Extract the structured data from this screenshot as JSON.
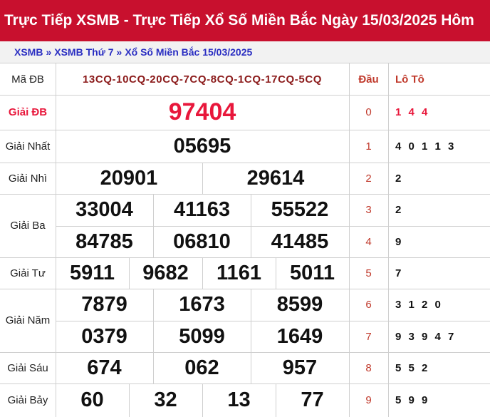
{
  "header": {
    "title": "Trực Tiếp XSMB - Trực Tiếp Xổ Số Miền Bắc Ngày 15/03/2025 Hôm"
  },
  "breadcrumb": {
    "items": [
      "XSMB",
      "XSMB Thứ 7",
      "Xổ Số Miền Bắc 15/03/2025"
    ],
    "separator": "»"
  },
  "table": {
    "code_label": "Mã ĐB",
    "code_value": "13CQ-10CQ-20CQ-7CQ-8CQ-1CQ-17CQ-5CQ",
    "dau_header": "Đầu",
    "loto_header": "Lô Tô",
    "prizes": {
      "db": {
        "label": "Giải ĐB",
        "numbers": [
          "97404"
        ]
      },
      "nhat": {
        "label": "Giải Nhất",
        "numbers": [
          "05695"
        ]
      },
      "nhi": {
        "label": "Giải Nhì",
        "numbers": [
          "20901",
          "29614"
        ]
      },
      "ba": {
        "label": "Giải Ba",
        "numbers": [
          "33004",
          "41163",
          "55522",
          "84785",
          "06810",
          "41485"
        ]
      },
      "tu": {
        "label": "Giải Tư",
        "numbers": [
          "5911",
          "9682",
          "1161",
          "5011"
        ]
      },
      "nam": {
        "label": "Giải Năm",
        "numbers": [
          "7879",
          "1673",
          "8599",
          "0379",
          "5099",
          "1649"
        ]
      },
      "sau": {
        "label": "Giải Sáu",
        "numbers": [
          "674",
          "062",
          "957"
        ]
      },
      "bay": {
        "label": "Giải Bảy",
        "numbers": [
          "60",
          "32",
          "13",
          "77"
        ]
      }
    },
    "loto": [
      {
        "dau": "0",
        "values": "1 4 4"
      },
      {
        "dau": "1",
        "values": "4 0 1 1 3"
      },
      {
        "dau": "2",
        "values": "2"
      },
      {
        "dau": "3",
        "values": "2"
      },
      {
        "dau": "4",
        "values": "9"
      },
      {
        "dau": "5",
        "values": "7"
      },
      {
        "dau": "6",
        "values": "3 1 2 0"
      },
      {
        "dau": "7",
        "values": "9 3 9 4 7"
      },
      {
        "dau": "8",
        "values": "5 5 2"
      },
      {
        "dau": "9",
        "values": "5 9 9"
      }
    ],
    "colors": {
      "header_bg": "#c8102e",
      "accent_red": "#e8173b",
      "link_blue": "#2a2ec2"
    }
  }
}
